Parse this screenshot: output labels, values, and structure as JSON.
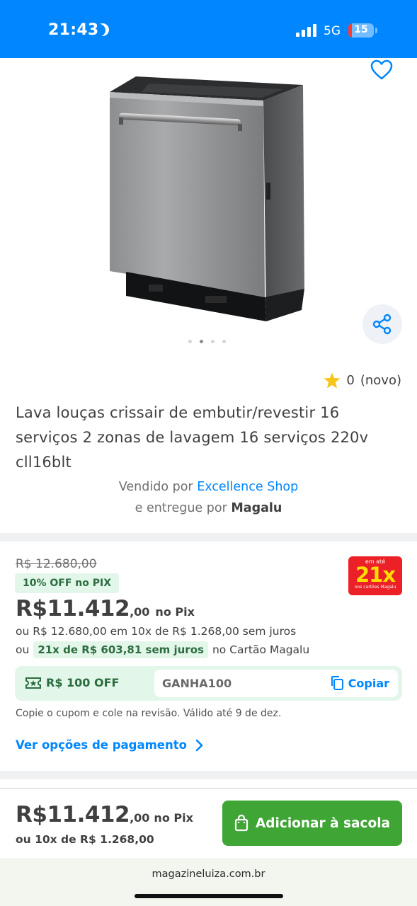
{
  "status_bar": {
    "time": "21:43",
    "network": "5G",
    "battery_level": "15",
    "battery_fill_percent": 15
  },
  "gallery": {
    "image_count": 4,
    "active_index": 1,
    "icons": {
      "favorite": "heart-outline-icon",
      "share": "share-icon"
    }
  },
  "product": {
    "rating_score": "0",
    "rating_label": "(novo)",
    "title": "Lava louças crissair de embutir/revestir 16 serviços 2 zonas de lavagem 16 serviços 220v cll16blt",
    "sold_by_prefix": "Vendido por",
    "seller_name": "Excellence Shop",
    "delivered_by_prefix": "e entregue por",
    "delivered_by": "Magalu"
  },
  "pricing": {
    "old_price": "R$ 12.680,00",
    "discount_badge": "10% OFF no PIX",
    "price_int": "R$11.412",
    "price_cents": ",00",
    "price_method": "no Pix",
    "installments_line1": "ou R$ 12.680,00 em 10x de R$ 1.268,00 sem juros",
    "installments_prefix": "ou",
    "installments_highlight": "21x de R$ 603,81 sem juros",
    "installments_suffix": "no Cartão Magalu",
    "card_badge": {
      "top": "em até",
      "big": "21x",
      "bottom": "nos cartões Magalu"
    }
  },
  "coupon": {
    "discount": "R$ 100 OFF",
    "code": "GANHA100",
    "copy_label": "Copiar",
    "note": "Copie o cupom e cole na revisão. Válido até 9 de dez."
  },
  "payment_options_label": "Ver opções de pagamento",
  "bottom_bar": {
    "price_int": "R$11.412",
    "price_cents": ",00",
    "price_method": "no Pix",
    "installments": "ou 10x de R$ 1.268,00",
    "add_button_label": "Adicionar à sacola"
  },
  "browser": {
    "url": "magazineluiza.com.br"
  },
  "colors": {
    "brand_blue": "#0086ff",
    "buy_green": "#3fa535",
    "promo_green_bg": "#e3f6ea",
    "promo_green_text": "#2c6d3f",
    "badge_red": "#ec2127",
    "star": "#f5c518"
  }
}
